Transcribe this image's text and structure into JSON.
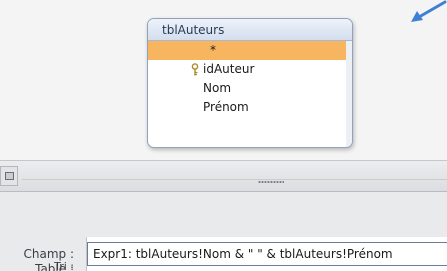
{
  "upper_pane": {
    "table": {
      "title": "tblAuteurs",
      "fields": [
        {
          "label": "*",
          "selected": true,
          "primary_key": false
        },
        {
          "label": "idAuteur",
          "selected": false,
          "primary_key": true
        },
        {
          "label": "Nom",
          "selected": false,
          "primary_key": false
        },
        {
          "label": "Prénom",
          "selected": false,
          "primary_key": false
        }
      ]
    }
  },
  "grid": {
    "rows": [
      {
        "label": "Champ :",
        "value": "Expr1: tblAuteurs!Nom & \" \" & tblAuteurs!Prénom"
      },
      {
        "label": "Table :",
        "value": ""
      },
      {
        "label": "Tri :",
        "value": ""
      }
    ]
  },
  "colors": {
    "selected_row": "#f7b560",
    "title_bar": "#d3deee",
    "arrow": "#3f7fd4",
    "grid_background": "#e9eaec"
  },
  "icons": [
    "arrow-icon",
    "key-icon",
    "splitter-icon"
  ]
}
